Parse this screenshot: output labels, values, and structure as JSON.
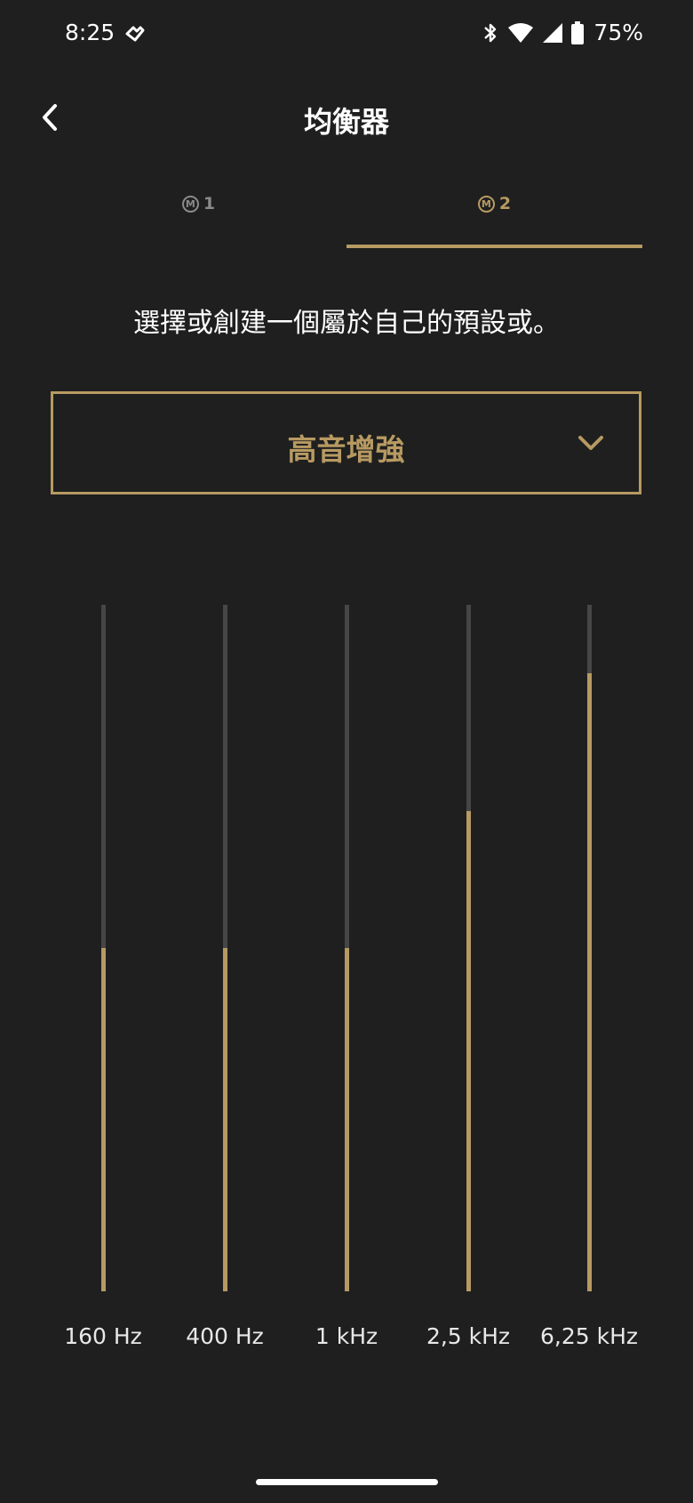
{
  "status": {
    "time": "8:25",
    "battery": "75%"
  },
  "header": {
    "title": "均衡器"
  },
  "tabs": [
    {
      "badge": "M",
      "label": "1",
      "active": false
    },
    {
      "badge": "M",
      "label": "2",
      "active": true
    }
  ],
  "subtitle": "選擇或創建一個屬於自己的預設或。",
  "preset": {
    "selected": "高音增強"
  },
  "colors": {
    "accent": "#b79a62",
    "background": "#1f1f1f",
    "track": "#464646"
  },
  "equalizer": {
    "level_range": [
      0,
      1
    ],
    "bands": [
      {
        "label": "160 Hz",
        "level": 0.5
      },
      {
        "label": "400 Hz",
        "level": 0.5
      },
      {
        "label": "1 kHz",
        "level": 0.5
      },
      {
        "label": "2,5 kHz",
        "level": 0.7
      },
      {
        "label": "6,25 kHz",
        "level": 0.9
      }
    ]
  }
}
